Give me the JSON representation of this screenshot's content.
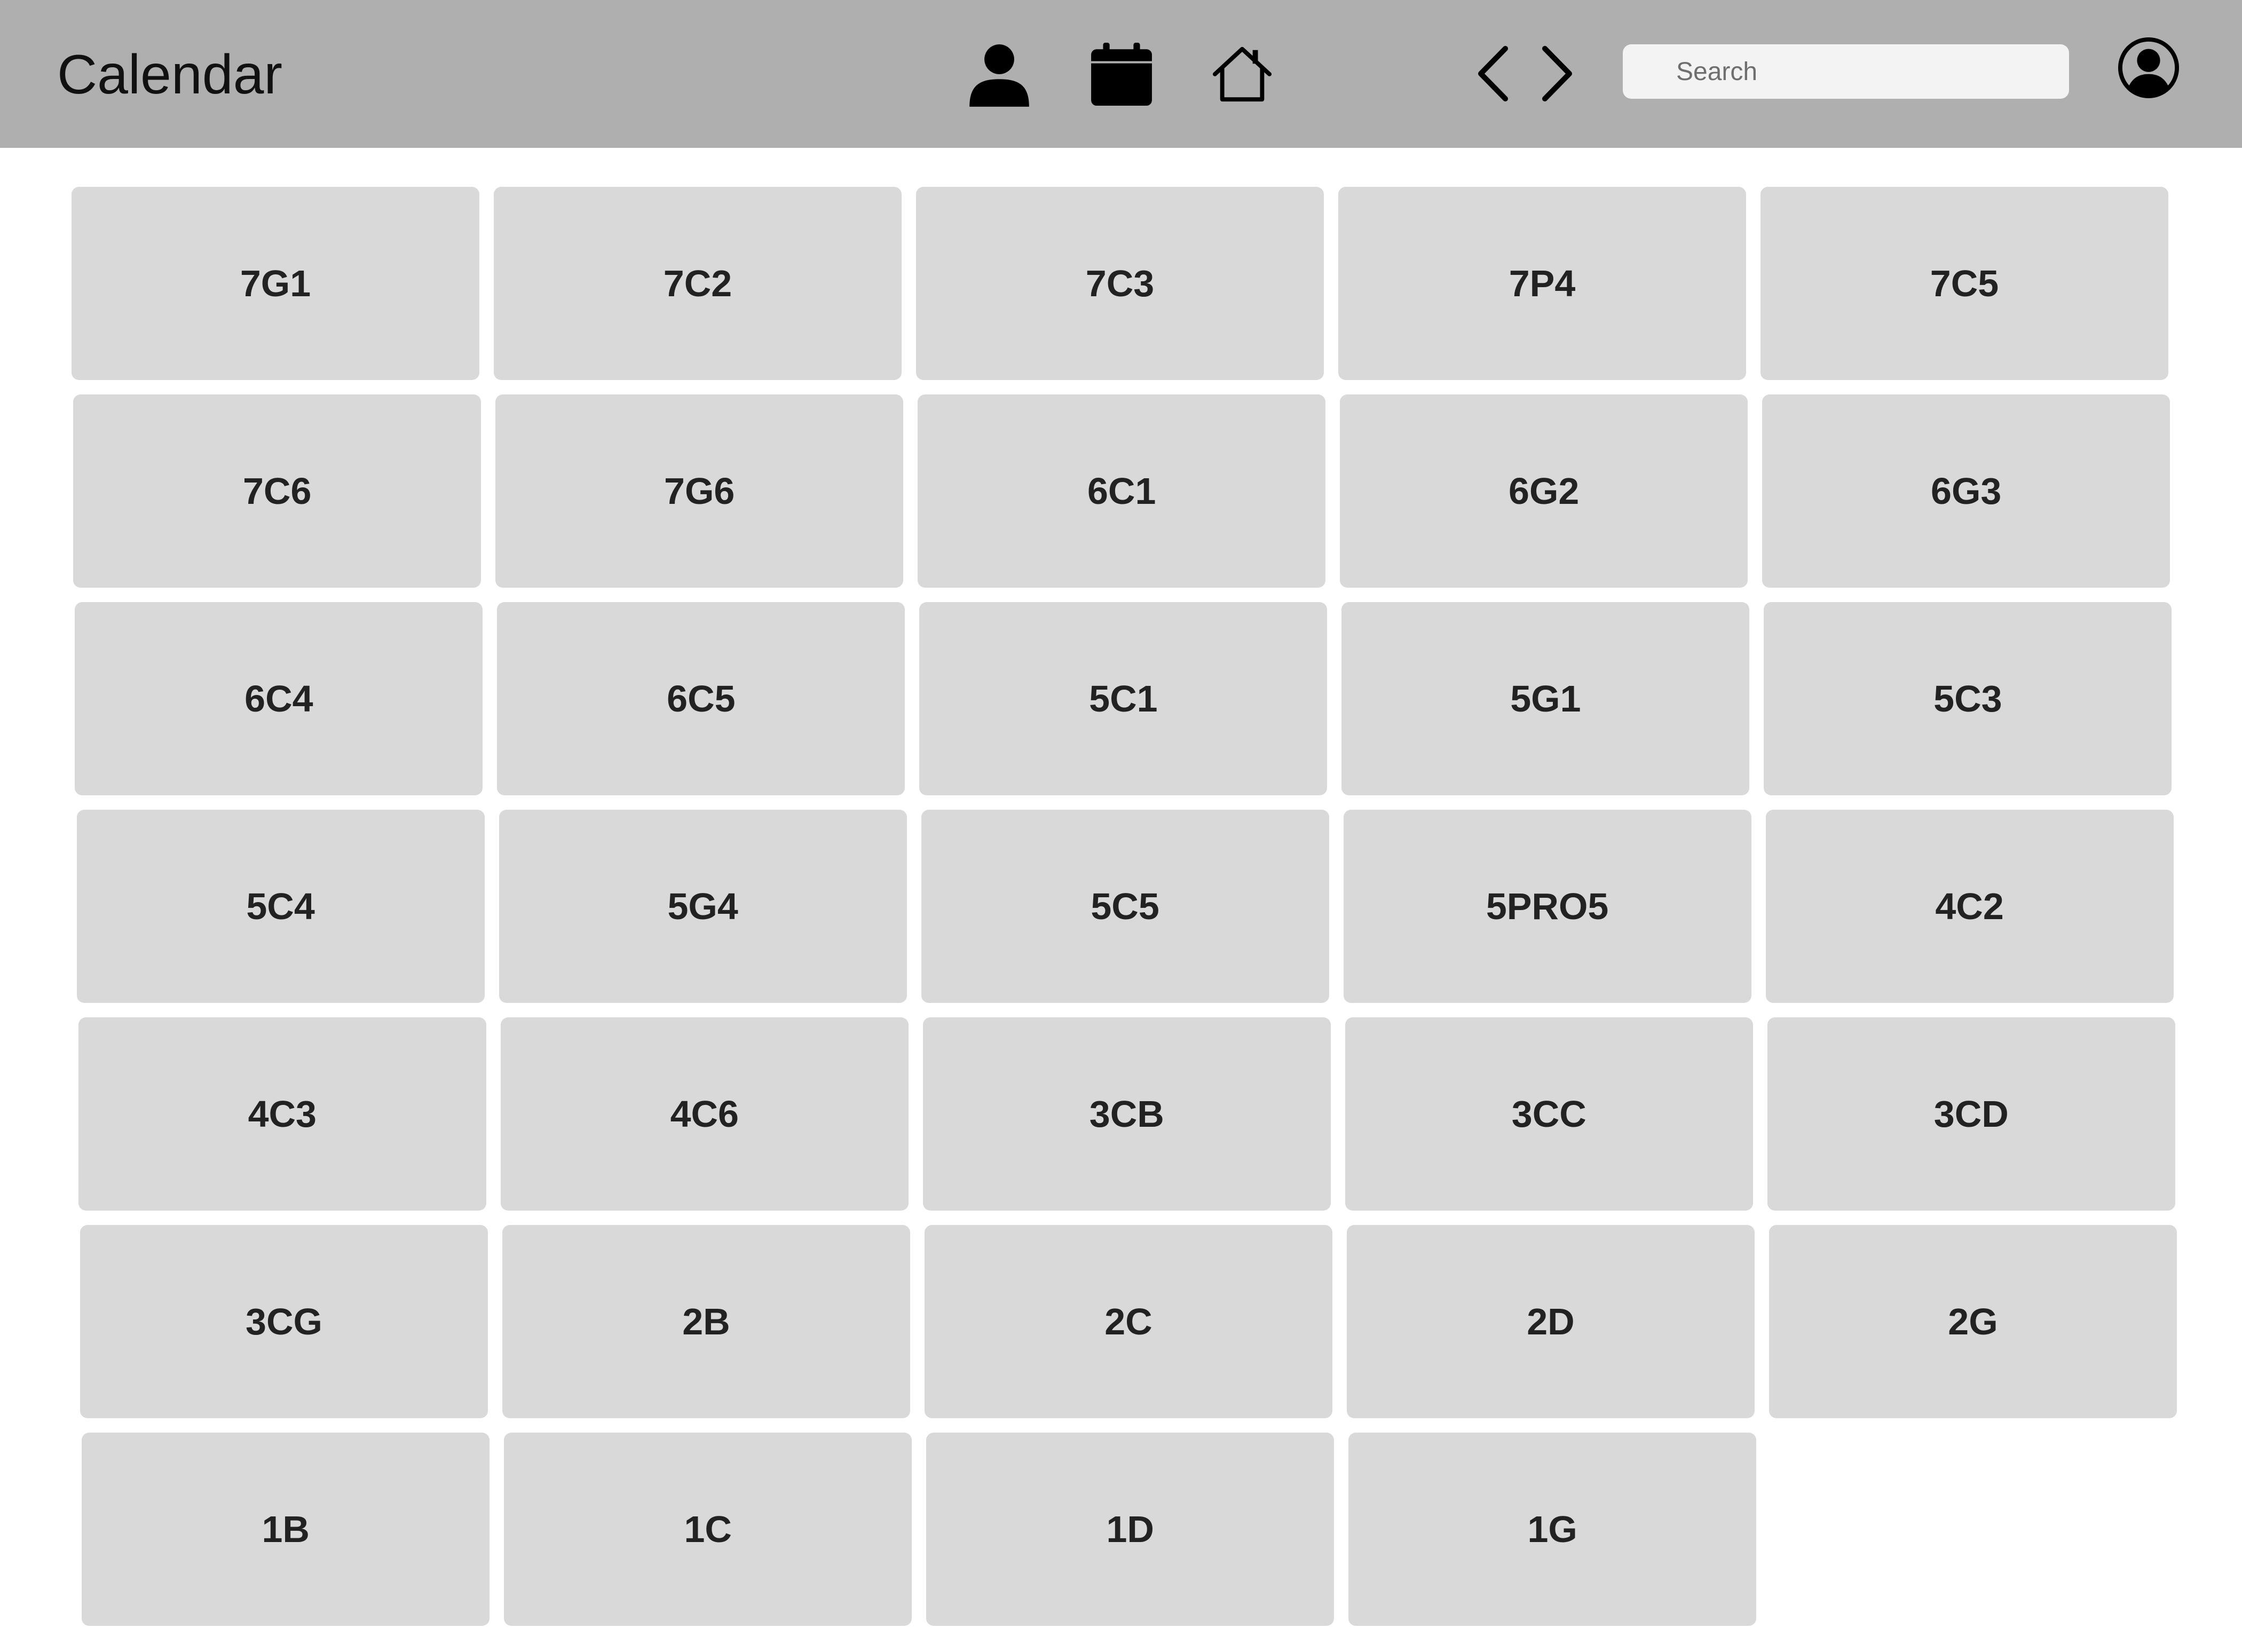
{
  "header": {
    "title": "Calendar",
    "icons": [
      "user-icon",
      "calendar-icon",
      "home-icon",
      "chevron-left-icon",
      "chevron-right-icon",
      "account-circle-icon"
    ],
    "search": {
      "placeholder": "Search",
      "value": ""
    }
  },
  "colors": {
    "header_bg": "#afafaf",
    "tile_bg": "#d9d9d9",
    "search_bg": "#f3f3f3",
    "text": "#222222"
  },
  "classes": [
    [
      "7G1",
      "7C2",
      "7C3",
      "7P4",
      "7C5"
    ],
    [
      "7C6",
      "7G6",
      "6C1",
      "6G2",
      "6G3"
    ],
    [
      "6C4",
      "6C5",
      "5C1",
      "5G1",
      "5C3"
    ],
    [
      "5C4",
      "5G4",
      "5C5",
      "5PRO5",
      "4C2"
    ],
    [
      "4C3",
      "4C6",
      "3CB",
      "3CC",
      "3CD"
    ],
    [
      "3CG",
      "2B",
      "2C",
      "2D",
      "2G"
    ],
    [
      "1B",
      "1C",
      "1D",
      "1G"
    ]
  ]
}
